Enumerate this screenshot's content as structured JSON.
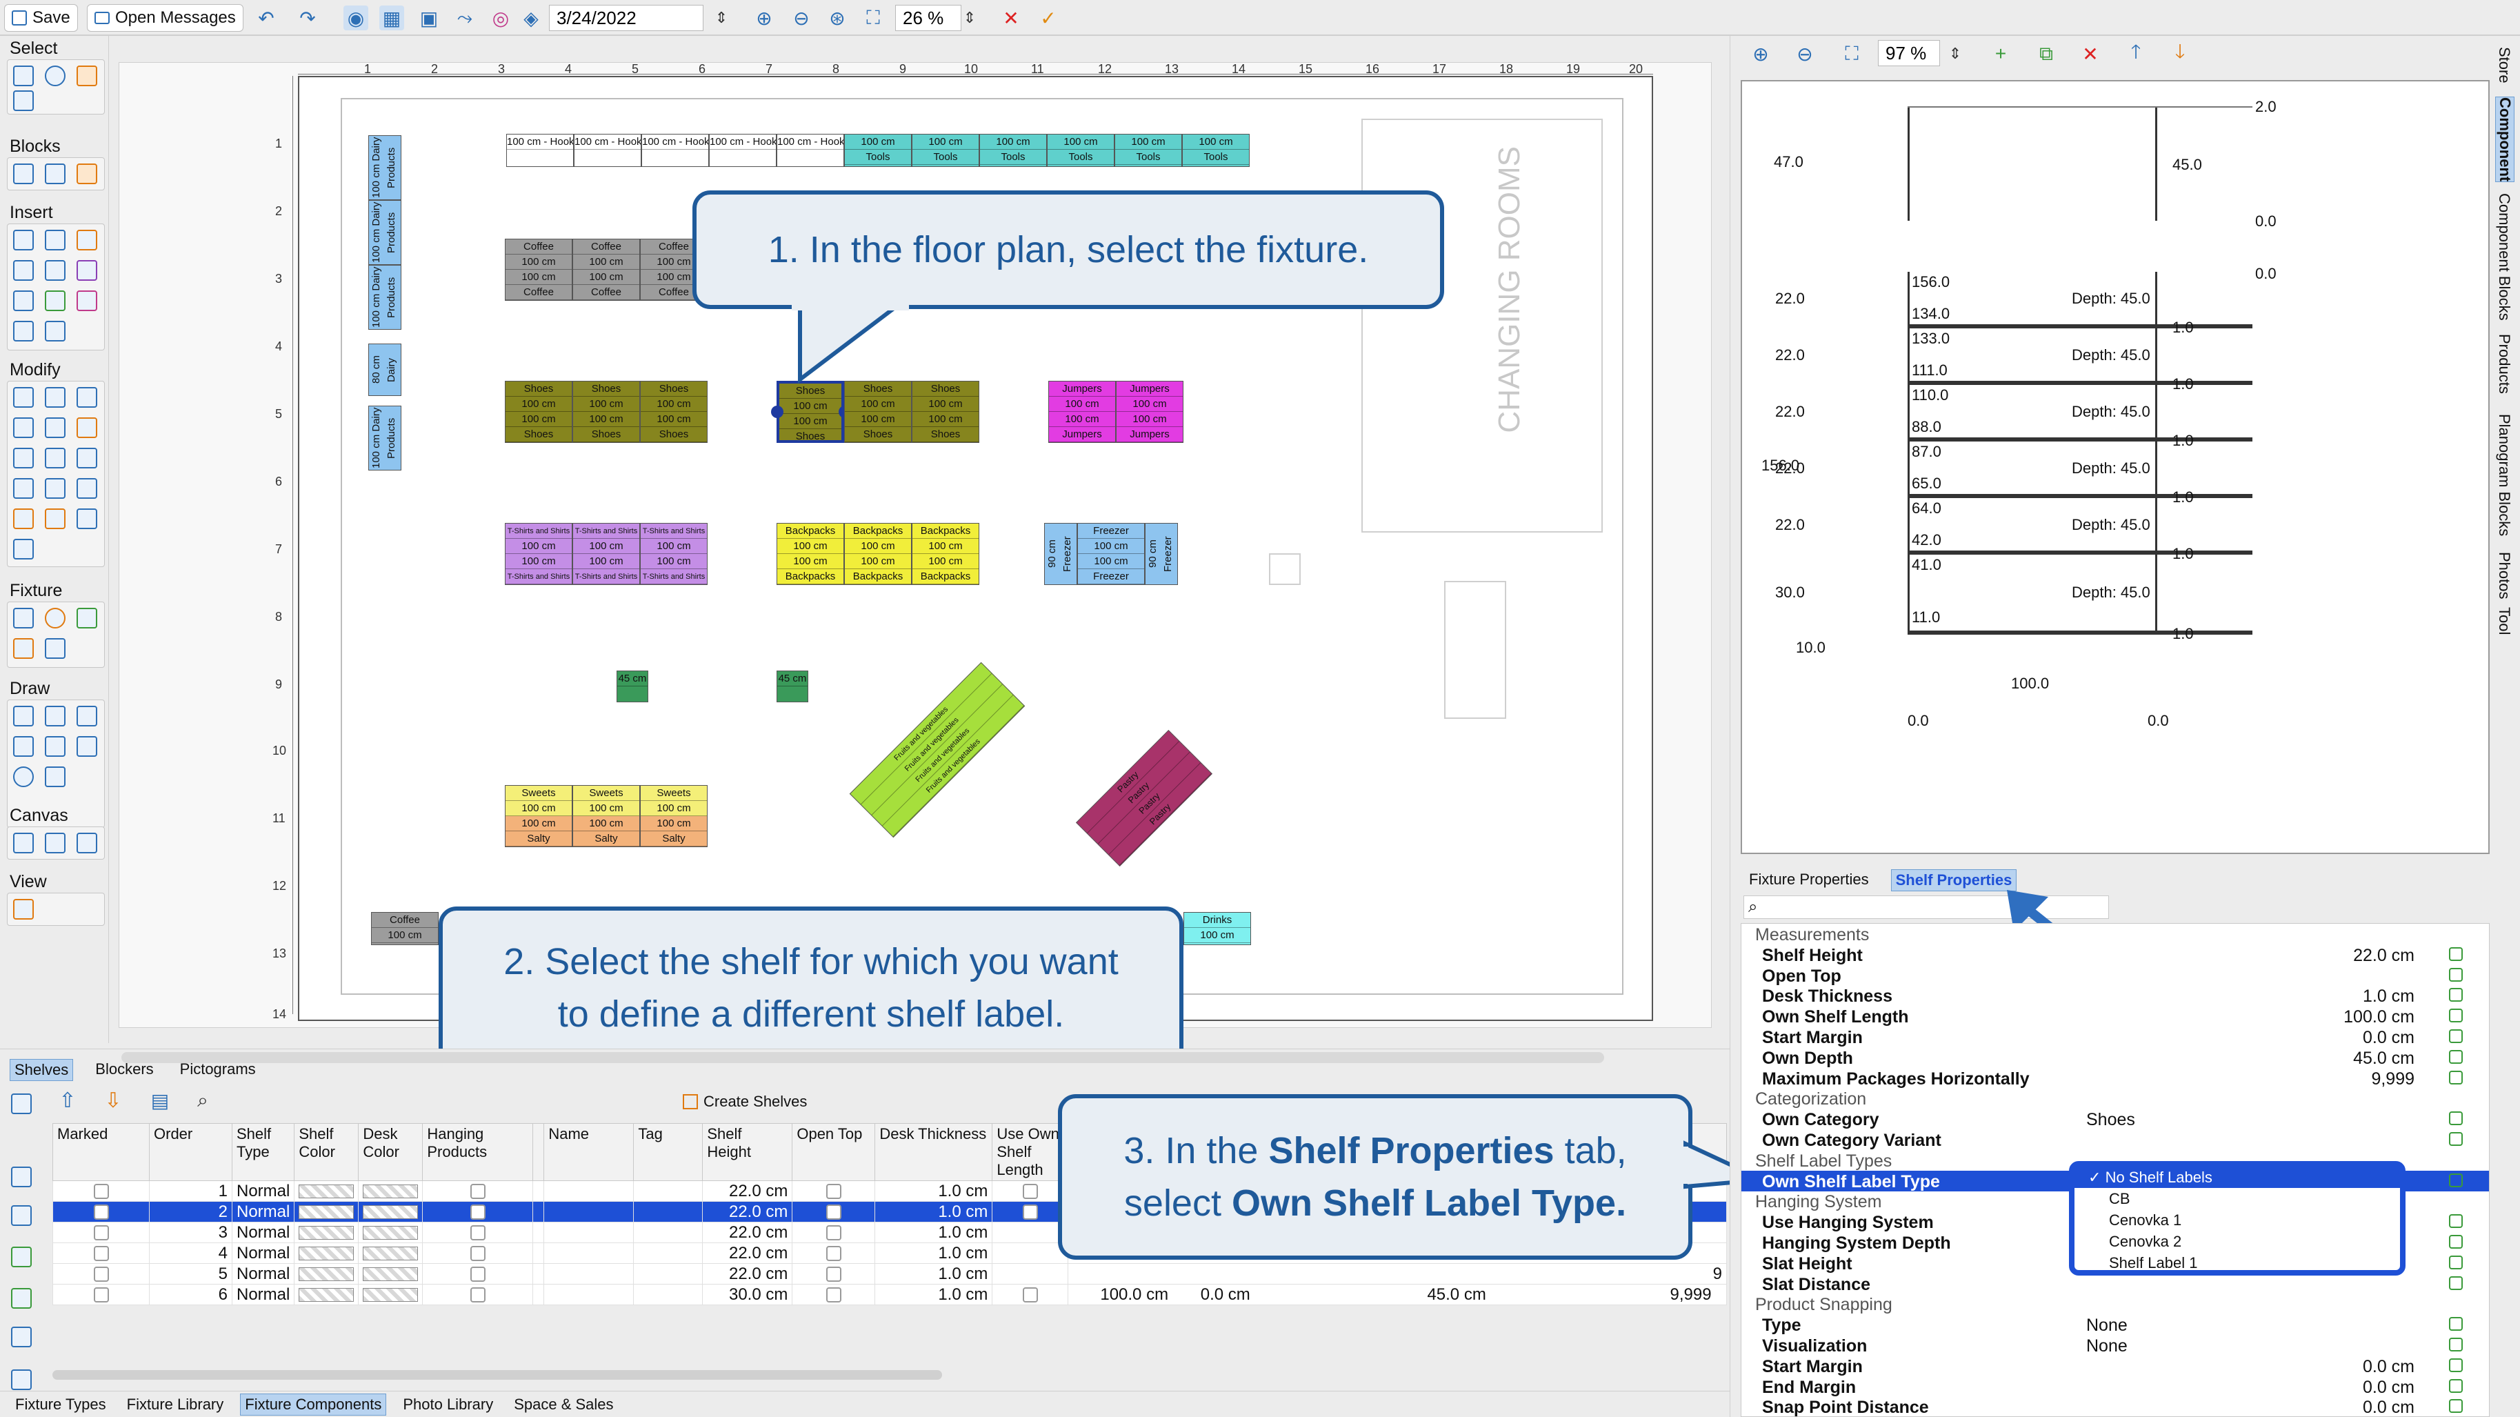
{
  "toolbar": {
    "save_label": "Save",
    "open_messages_label": "Open Messages",
    "date_value": "3/24/2022",
    "zoom_value": "26 %"
  },
  "left_tools": {
    "sections": [
      "Select",
      "Blocks",
      "Insert",
      "Modify",
      "Fixture",
      "Draw",
      "Canvas",
      "View"
    ]
  },
  "ruler_h": [
    "1",
    "2",
    "3",
    "4",
    "5",
    "6",
    "7",
    "8",
    "9",
    "10",
    "11",
    "12",
    "13",
    "14",
    "15",
    "16",
    "17",
    "18",
    "19",
    "20"
  ],
  "ruler_v": [
    "1",
    "2",
    "3",
    "4",
    "5",
    "6",
    "7",
    "8",
    "9",
    "10",
    "11",
    "12",
    "13",
    "14"
  ],
  "floor": {
    "room_label": "CHANGING ROOMS",
    "hooks": [
      "100 cm - Hook1",
      "100 cm - Hook2",
      "100 cm - Hook3",
      "100 cm - Hook4",
      "100 cm - Hook5"
    ],
    "tools": [
      "100 cm",
      "Tools"
    ],
    "dairy": [
      "100 cm",
      "Dairy Products"
    ],
    "dairy_short": "80 cm",
    "coffee": [
      "Coffee",
      "100 cm",
      "100 cm",
      "Coffee"
    ],
    "shoes": [
      "Shoes",
      "100 cm",
      "100 cm",
      "Shoes"
    ],
    "jumpers": [
      "Jumpers",
      "100 cm",
      "100 cm",
      "Jumpers"
    ],
    "tshirts": [
      "T-Shirts and Shirts",
      "100 cm",
      "100 cm",
      "T-Shirts and Shirts"
    ],
    "backpacks": [
      "Backpacks",
      "100 cm",
      "100 cm",
      "Backpacks"
    ],
    "freezer": [
      "Freezer",
      "100 cm",
      "100 cm",
      "Freezer"
    ],
    "freezer_side": "90 cm Freezer",
    "small": "45 cm",
    "sweets": [
      "Sweets",
      "100 cm",
      "100 cm",
      "Salty"
    ],
    "drinks": [
      "Drinks",
      "100 cm"
    ],
    "coffee_bottom": [
      "Coffee",
      "100 cm"
    ],
    "fruit_label": "Fruits and vegetables",
    "pastry_label": "Pastry"
  },
  "callouts": {
    "c1": "1. In the floor plan, select the fixture.",
    "c2_line1": "2. Select the shelf for which you want",
    "c2_line2": "to define a different shelf label.",
    "c3_line1_pre": "3. In the ",
    "c3_line1_bold": "Shelf Properties",
    "c3_line1_post": " tab,",
    "c3_line2_pre": "select ",
    "c3_line2_bold": "Own Shelf Label Type."
  },
  "bottom": {
    "tabs": [
      "Shelves",
      "Blockers",
      "Pictograms"
    ],
    "create_shelves": "Create Shelves",
    "headers": [
      "Marked",
      "Order",
      "Shelf Type",
      "Shelf Color",
      "Desk Color",
      "Hanging Products",
      "",
      "Name",
      "Tag",
      "Shelf Height",
      "Open Top",
      "Desk Thickness",
      "Use Own Shelf Length"
    ],
    "rows": [
      {
        "order": "1",
        "type": "Normal",
        "height": "22.0 cm",
        "thickness": "1.0 cm"
      },
      {
        "order": "2",
        "type": "Normal",
        "height": "22.0 cm",
        "thickness": "1.0 cm"
      },
      {
        "order": "3",
        "type": "Normal",
        "height": "22.0 cm",
        "thickness": "1.0 cm"
      },
      {
        "order": "4",
        "type": "Normal",
        "height": "22.0 cm",
        "thickness": "1.0 cm"
      },
      {
        "order": "5",
        "type": "Normal",
        "height": "22.0 cm",
        "thickness": "1.0 cm"
      },
      {
        "order": "6",
        "type": "Normal",
        "height": "30.0 cm",
        "thickness": "1.0 cm"
      }
    ],
    "row6_extra": [
      "100.0 cm",
      "0.0 cm",
      "45.0 cm",
      "9,999"
    ],
    "row5_extra": "9"
  },
  "footer_tabs": [
    "Fixture Types",
    "Fixture Library",
    "Fixture Components",
    "Photo Library",
    "Space & Sales"
  ],
  "right": {
    "zoom_value": "97 %",
    "vtabs": [
      "Store",
      "Component",
      "Component Blocks",
      "Products",
      "Planogram Blocks",
      "Photos",
      "Tool"
    ],
    "preview": {
      "top_labels": [
        "2.0",
        "47.0",
        "45.0",
        "0.0",
        "0.0"
      ],
      "shelves": [
        {
          "top": "156.0",
          "bottom": "134.0",
          "gap": "22.0",
          "depth": "Depth: 45.0",
          "thick": "1.0"
        },
        {
          "top": "133.0",
          "bottom": "111.0",
          "gap": "22.0",
          "depth": "Depth: 45.0",
          "thick": "1.0"
        },
        {
          "top": "110.0",
          "bottom": "88.0",
          "gap": "22.0",
          "depth": "Depth: 45.0",
          "thick": "1.0"
        },
        {
          "top": "87.0",
          "bottom": "65.0",
          "gap": "22.0",
          "depth": "Depth: 45.0",
          "thick": "1.0"
        },
        {
          "top": "64.0",
          "bottom": "42.0",
          "gap": "22.0",
          "depth": "Depth: 45.0",
          "thick": "1.0"
        },
        {
          "top": "41.0",
          "bottom": "11.0",
          "gap": "30.0",
          "depth": "Depth: 45.0",
          "thick": "1.0"
        }
      ],
      "total_height": "156.0",
      "base": "10.0",
      "width": "100.0",
      "x_left": "0.0",
      "x_right": "0.0"
    },
    "prop_tabs": [
      "Fixture Properties",
      "Shelf Properties"
    ],
    "props": [
      {
        "k": "Measurements",
        "v": "",
        "grp": true
      },
      {
        "k": "Shelf Height",
        "v": "22.0 cm"
      },
      {
        "k": "Open Top",
        "v": ""
      },
      {
        "k": "Desk Thickness",
        "v": "1.0 cm"
      },
      {
        "k": "Own Shelf Length",
        "v": "100.0 cm"
      },
      {
        "k": "Start Margin",
        "v": "0.0 cm"
      },
      {
        "k": "Own Depth",
        "v": "45.0 cm"
      },
      {
        "k": "Maximum Packages Horizontally",
        "v": "9,999"
      },
      {
        "k": "Categorization",
        "v": "",
        "grp": true
      },
      {
        "k": "Own Category",
        "v": "Shoes",
        "left": true
      },
      {
        "k": "Own Category Variant",
        "v": ""
      },
      {
        "k": "Shelf Label Types",
        "v": "",
        "grp": true
      },
      {
        "k": "Own Shelf Label Type",
        "v": "",
        "hl": true
      },
      {
        "k": "Hanging System",
        "v": "",
        "grp": true
      },
      {
        "k": "Use Hanging System",
        "v": ""
      },
      {
        "k": "Hanging System Depth",
        "v": ""
      },
      {
        "k": "Slat Height",
        "v": ""
      },
      {
        "k": "Slat Distance",
        "v": ""
      },
      {
        "k": "Product Snapping",
        "v": "",
        "grp": true
      },
      {
        "k": "Type",
        "v": "None",
        "left": true
      },
      {
        "k": "Visualization",
        "v": "None",
        "left": true
      },
      {
        "k": "Start Margin",
        "v": "0.0 cm"
      },
      {
        "k": "End Margin",
        "v": "0.0 cm"
      },
      {
        "k": "Snap Point Distance",
        "v": "0.0 cm"
      }
    ],
    "dropdown": [
      "No Shelf Labels",
      "CB",
      "Cenovka 1",
      "Cenovka 2",
      "Shelf Label 1"
    ],
    "check_mark": "✓"
  }
}
